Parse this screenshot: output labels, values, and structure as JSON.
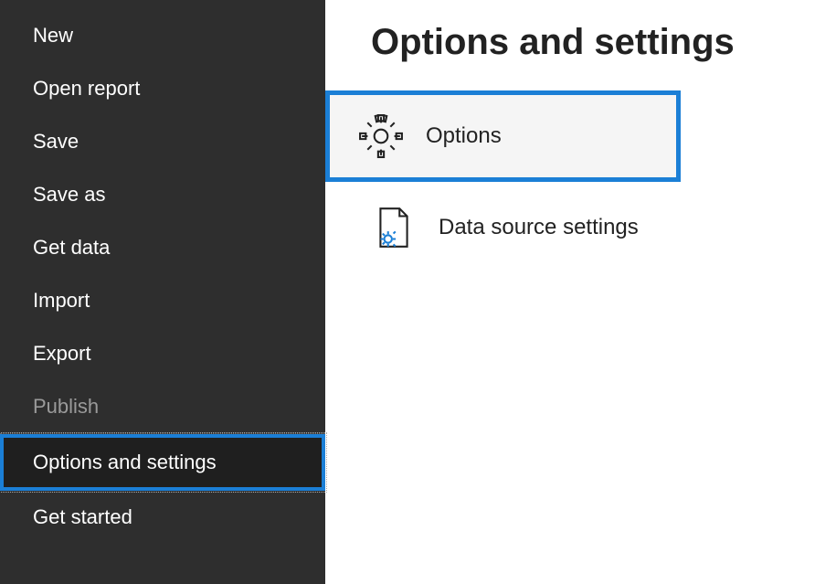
{
  "sidebar": {
    "items": [
      {
        "label": "New"
      },
      {
        "label": "Open report"
      },
      {
        "label": "Save"
      },
      {
        "label": "Save as"
      },
      {
        "label": "Get data"
      },
      {
        "label": "Import"
      },
      {
        "label": "Export"
      },
      {
        "label": "Publish"
      },
      {
        "label": "Options and settings"
      },
      {
        "label": "Get started"
      }
    ]
  },
  "main": {
    "title": "Options and settings",
    "options_label": "Options",
    "data_source_label": "Data source settings"
  },
  "colors": {
    "highlight": "#1b7fd6",
    "sidebar_bg": "#2e2e2e"
  }
}
